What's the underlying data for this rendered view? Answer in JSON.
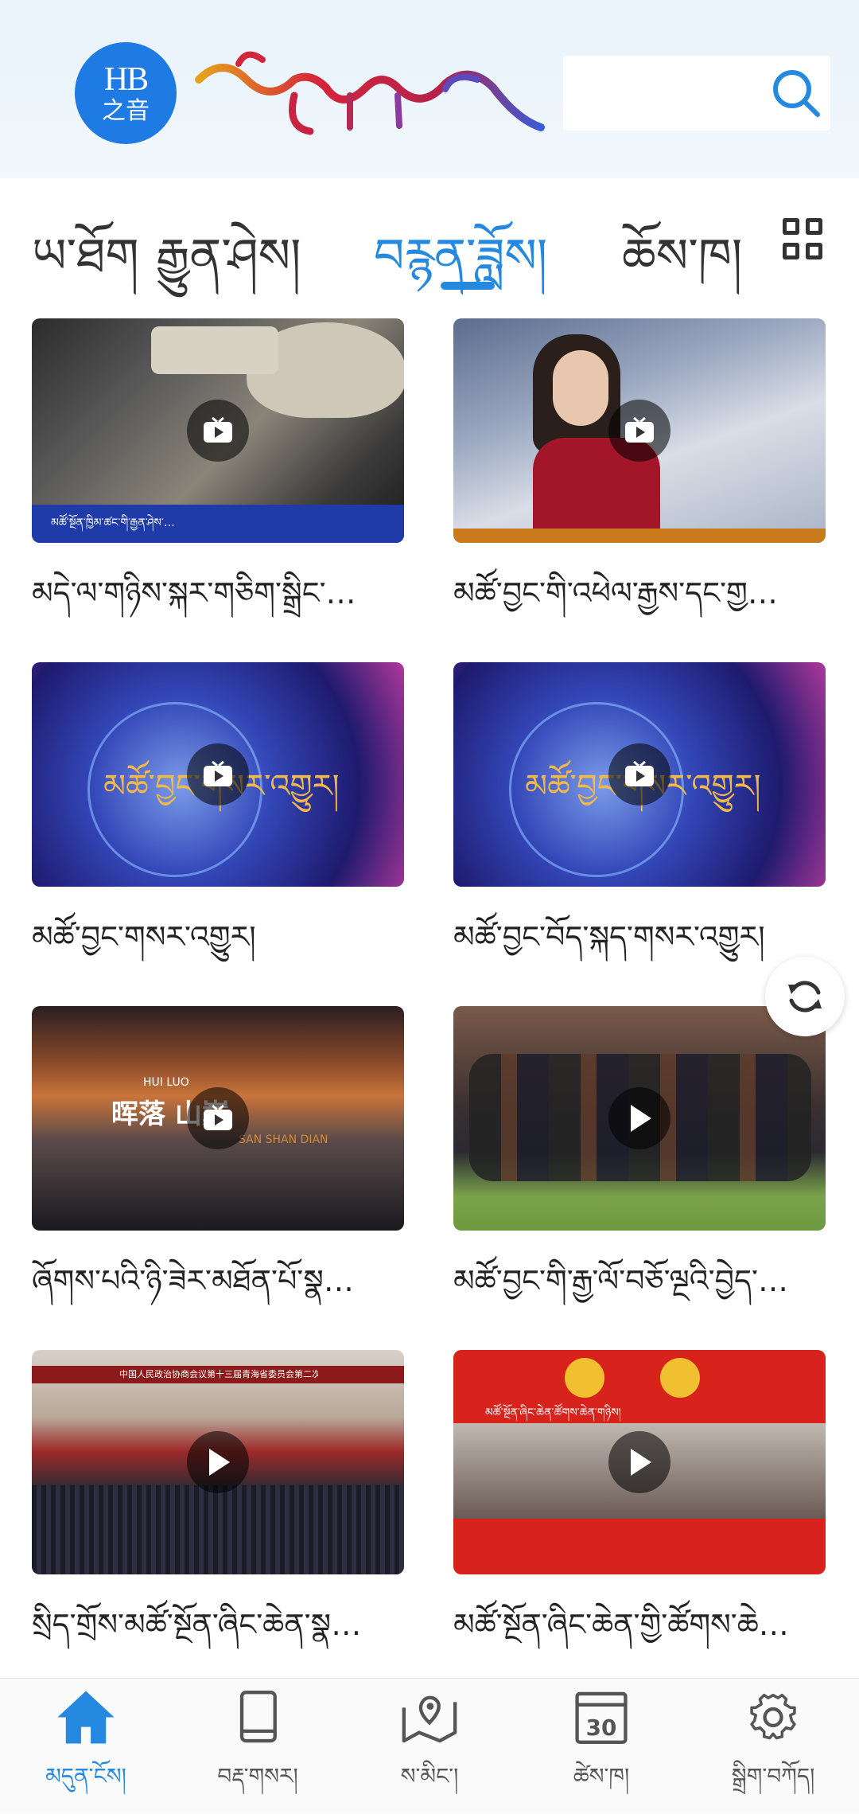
{
  "header": {
    "logo_text_1": "HB",
    "logo_text_2": "之音",
    "brand_color": "#1e7be3",
    "search_icon": "search-icon"
  },
  "tabs": [
    {
      "label": "ཡ་ཐོག",
      "active": false
    },
    {
      "label": "རྒྱུན་ཤེས།",
      "active": false
    },
    {
      "label": "བརྙན་ཟློས།",
      "active": true
    },
    {
      "label": "ཆོས་ཁ།",
      "active": false
    }
  ],
  "accent_color": "#2589df",
  "videos": [
    {
      "title": "མདེ་ལ་གཉིས་སྐར་གཅིག་སྒྲིང་…",
      "icon": "video-badge-icon",
      "overlay_text": "མཚོ་སྔོན་ཁྱིམ་ཚང་གི་རྒྱན་ཤེས་…"
    },
    {
      "title": "མཚོ་བྱང་གི་འཕེལ་རྒྱས་དང་གྱ…",
      "icon": "video-badge-icon"
    },
    {
      "title": "མཚོ་བྱང་གསར་འགྱུར།",
      "icon": "video-badge-icon",
      "overlay_text": "མཚོ་བྱང་གསར་འགྱུར།"
    },
    {
      "title": "མཚོ་བྱང་བོད་སྐད་གསར་འགྱུར།",
      "icon": "video-badge-icon",
      "overlay_text": "མཚོ་བྱང་གསར་འགྱུར།"
    },
    {
      "title": "ཞོགས་པའི་ཉི་ཟེར་མཐོན་པོ་སྣ…",
      "icon": "video-badge-icon",
      "overlay_text": "晖落 山巅",
      "overlay_sub1": "HUI LUO",
      "overlay_sub2": "SAN SHAN DIAN"
    },
    {
      "title": "མཚོ་བྱང་གི་རྒྱ་ལོ་བཅོ་ལྔའི་བྱེད་…",
      "icon": "play-icon"
    },
    {
      "title": "སྲིད་གྲོས་མཚོ་སྔོན་ཞིང་ཆེན་སྣ…",
      "icon": "play-icon",
      "overlay_text": "中国人民政治协商会议第十三届青海省委员会第二次会议"
    },
    {
      "title": "མཚོ་སྔོན་ཞིང་ཆེན་གྱི་ཚོགས་ཆེ…",
      "icon": "play-icon",
      "overlay_text": "མཚོ་སྔོན་ཞིང་ཆེན་ཚོགས་ཆེན་གཉིས།"
    }
  ],
  "bottom_nav": [
    {
      "label": "མདུན་ངོས།",
      "icon": "home-icon",
      "active": true
    },
    {
      "label": "བརྡ་གསར།",
      "icon": "book-icon",
      "active": false
    },
    {
      "label": "ས་མིང་།",
      "icon": "map-icon",
      "active": false
    },
    {
      "label": "ཚེས་ཁ།",
      "icon": "calendar-icon",
      "active": false,
      "icon_text": "30"
    },
    {
      "label": "སྒྲིག་བཀོད།",
      "icon": "gear-icon",
      "active": false
    }
  ]
}
